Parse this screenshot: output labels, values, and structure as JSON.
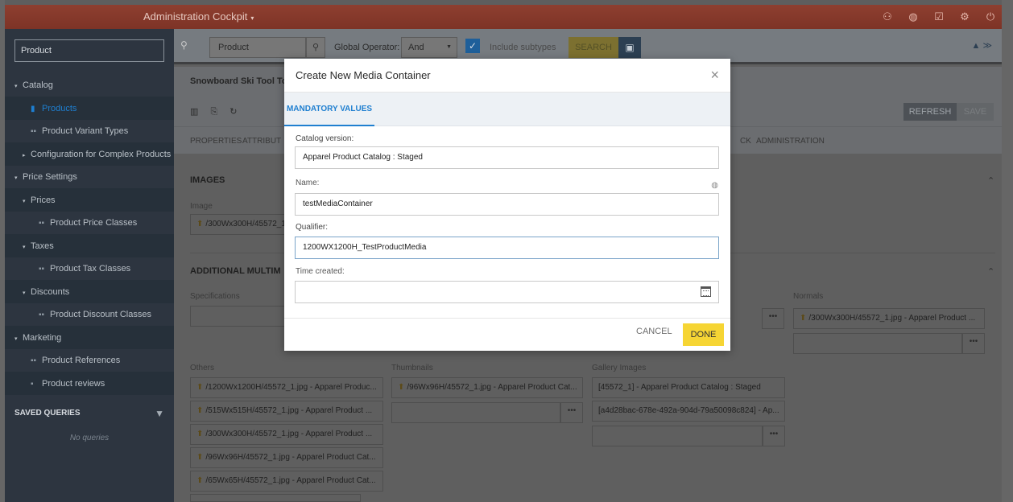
{
  "app": {
    "title": "Administration Cockpit",
    "title_caret": "▾",
    "top_icons": [
      "user-icon",
      "globe-icon",
      "checklist-icon",
      "settings-icon",
      "power-icon"
    ]
  },
  "sidebar": {
    "search_value": "Product",
    "items": [
      {
        "label": "Catalog",
        "level": 0,
        "arrow": "▾",
        "icon": ""
      },
      {
        "label": "Products",
        "level": 1,
        "arrow": "",
        "icon": "▮"
      },
      {
        "label": "Product Variant Types",
        "level": 1,
        "arrow": "",
        "icon": "▪▪"
      },
      {
        "label": "Configuration for Complex Products",
        "level": 1,
        "arrow": "▸",
        "icon": ""
      },
      {
        "label": "Price Settings",
        "level": 0,
        "arrow": "▾",
        "icon": ""
      },
      {
        "label": "Prices",
        "level": 1,
        "arrow": "▾",
        "icon": ""
      },
      {
        "label": "Product Price Classes",
        "level": 2,
        "arrow": "",
        "icon": "▪▪"
      },
      {
        "label": "Taxes",
        "level": 1,
        "arrow": "▾",
        "icon": ""
      },
      {
        "label": "Product Tax Classes",
        "level": 2,
        "arrow": "",
        "icon": "▪▪"
      },
      {
        "label": "Discounts",
        "level": 1,
        "arrow": "▾",
        "icon": ""
      },
      {
        "label": "Product Discount Classes",
        "level": 2,
        "arrow": "",
        "icon": "▪▪"
      },
      {
        "label": "Marketing",
        "level": 0,
        "arrow": "▾",
        "icon": ""
      },
      {
        "label": "Product References",
        "level": 1,
        "arrow": "",
        "icon": "▪▪"
      },
      {
        "label": "Product reviews",
        "level": 1,
        "arrow": "",
        "icon": "▪"
      }
    ],
    "saved_queries_title": "SAVED QUERIES",
    "no_queries": "No queries"
  },
  "searchbar": {
    "query": "Product",
    "operator_label": "Global Operator:",
    "operator_value": "And",
    "include_subtypes": "Include subtypes",
    "search_button": "SEARCH"
  },
  "editor": {
    "title": "Snowboard Ski Tool To",
    "refresh": "REFRESH",
    "save": "SAVE",
    "tabs": [
      "PROPERTIES",
      "ATTRIBUT",
      "CK",
      "ADMINISTRATION"
    ],
    "images_title": "IMAGES",
    "image_label": "Image",
    "image_value": "/300Wx300H/45572_1",
    "additional_title": "ADDITIONAL MULTIM",
    "specifications_label": "Specifications",
    "normals_label": "Normals",
    "normals_value": "/300Wx300H/45572_1.jpg - Apparel Product ...",
    "others_label": "Others",
    "others_values": [
      "/1200Wx1200H/45572_1.jpg - Apparel Produc...",
      "/515Wx515H/45572_1.jpg - Apparel Product ...",
      "/300Wx300H/45572_1.jpg - Apparel Product ...",
      "/96Wx96H/45572_1.jpg - Apparel Product Cat...",
      "/65Wx65H/45572_1.jpg - Apparel Product Cat..."
    ],
    "thumbnails_label": "Thumbnails",
    "thumbnails_value": "/96Wx96H/45572_1.jpg - Apparel Product Cat...",
    "gallery_label": "Gallery Images",
    "gallery_values": [
      "[45572_1] - Apparel Product Catalog : Staged",
      "[a4d28bac-678e-492a-904d-79a50098c824] - Ap..."
    ],
    "dots": "•••"
  },
  "modal": {
    "title": "Create New Media Container",
    "tab": "MANDATORY VALUES",
    "fields": {
      "catalog_version_label": "Catalog version:",
      "catalog_version_value": "Apparel Product Catalog : Staged",
      "name_label": "Name:",
      "name_value": "testMediaContainer",
      "qualifier_label": "Qualifier:",
      "qualifier_value": "1200WX1200H_TestProductMedia",
      "time_created_label": "Time created:",
      "time_created_value": ""
    },
    "cancel": "CANCEL",
    "done": "DONE"
  },
  "colors": {
    "topbar": "#8e3f30",
    "sidebar": "#2d3540",
    "accent_blue": "#1f7fd0",
    "done_yellow": "#f6d534"
  }
}
